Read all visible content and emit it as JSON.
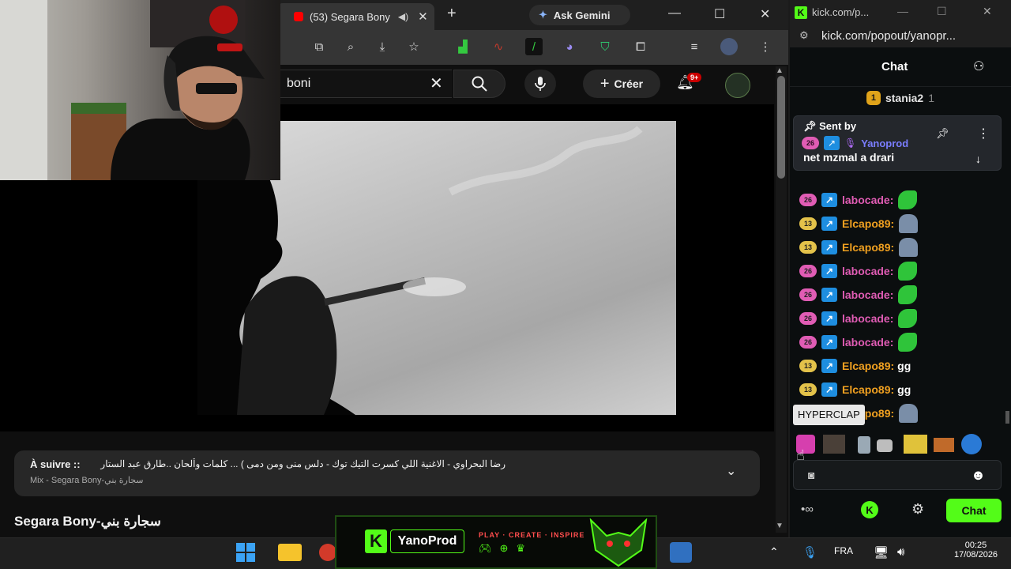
{
  "browser": {
    "tab_title": "(53) Segara Bony",
    "gemini_label": "Ask Gemini"
  },
  "youtube": {
    "search_value": "boni",
    "create_label": "Créer",
    "notif_badge": "9+",
    "up_next_label": "À suivre ::",
    "up_next_title": "رضا البحراوي - الاغنية اللي كسرت التيك توك - دلس منى ومن دمى ) ... كلمات وألحان ..طارق عبد الستار",
    "up_next_sub": "Mix - Segara Bony-سجارة بني",
    "video_title": "Segara Bony-سجارة بني"
  },
  "kick": {
    "window_title": "kick.com/p...",
    "url": "kick.com/popout/yanopr...",
    "header_title": "Chat",
    "top_user": {
      "rank": "1",
      "name": "stania2",
      "count": "1"
    },
    "pinned": {
      "label": "Sent by",
      "sub_badge": "26",
      "user": "Yanoprod",
      "text": "net mzmal a drari"
    },
    "messages": [
      {
        "badge": "26",
        "badge_color": "#e05cb4",
        "user": "labocade:",
        "user_color": "#e05cb4",
        "text": "",
        "emote": "frog-emote"
      },
      {
        "badge": "13",
        "badge_color": "#e3c24a",
        "user": "Elcapo89:",
        "user_color": "#f0a020",
        "text": "",
        "emote": "guy-emote"
      },
      {
        "badge": "13",
        "badge_color": "#e3c24a",
        "user": "Elcapo89:",
        "user_color": "#f0a020",
        "text": "",
        "emote": "guy-emote"
      },
      {
        "badge": "26",
        "badge_color": "#e05cb4",
        "user": "labocade:",
        "user_color": "#e05cb4",
        "text": "",
        "emote": "frog-emote"
      },
      {
        "badge": "26",
        "badge_color": "#e05cb4",
        "user": "labocade:",
        "user_color": "#e05cb4",
        "text": "",
        "emote": "frog-emote"
      },
      {
        "badge": "26",
        "badge_color": "#e05cb4",
        "user": "labocade:",
        "user_color": "#e05cb4",
        "text": "",
        "emote": "frog-emote"
      },
      {
        "badge": "26",
        "badge_color": "#e05cb4",
        "user": "labocade:",
        "user_color": "#e05cb4",
        "text": "",
        "emote": "frog-emote"
      },
      {
        "badge": "13",
        "badge_color": "#e3c24a",
        "user": "Elcapo89:",
        "user_color": "#f0a020",
        "text": "gg",
        "emote": ""
      },
      {
        "badge": "13",
        "badge_color": "#e3c24a",
        "user": "Elcapo89:",
        "user_color": "#f0a020",
        "text": "gg",
        "emote": ""
      },
      {
        "badge": "13",
        "badge_color": "#e3c24a",
        "user": "Elcapo89:",
        "user_color": "#f0a020",
        "text": "",
        "emote": "guy-emote"
      }
    ],
    "tooltip": "HYPERCLAP",
    "chat_button": "Chat",
    "accent": "#53fc18"
  },
  "banner": {
    "brand": "YanoProd",
    "tagline": "PLAY · CREATE · INSPIRE"
  },
  "taskbar": {
    "language": "FRA",
    "time": "00:25",
    "date": "17/08/2026"
  }
}
